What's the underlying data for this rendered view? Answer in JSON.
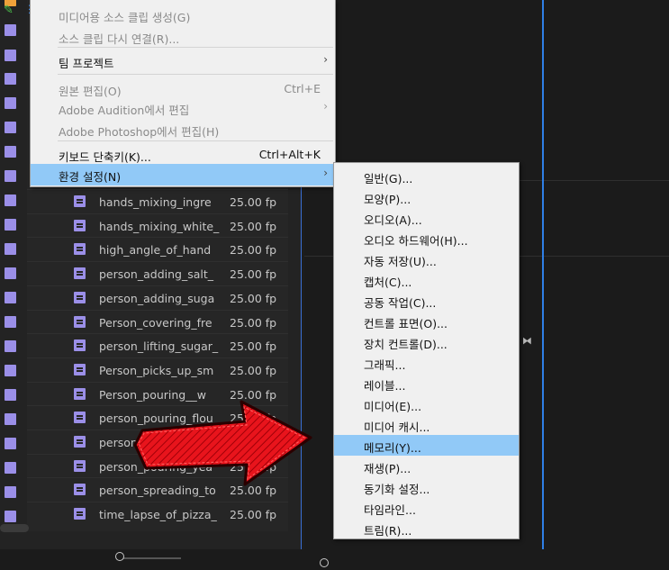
{
  "project_panel": {
    "clips": [
      {
        "name": "hands_mixing_ingre",
        "fps": "25.00 fps"
      },
      {
        "name": "hands_mixing_white_",
        "fps": "25.00 fps"
      },
      {
        "name": "high_angle_of_hand",
        "fps": "25.00 fps"
      },
      {
        "name": "person_adding_salt_",
        "fps": "25.00 fps"
      },
      {
        "name": "person_adding_suga",
        "fps": "25.00 fps"
      },
      {
        "name": "Person_covering_fre",
        "fps": "25.00 fps"
      },
      {
        "name": "person_lifting_sugar_",
        "fps": "25.00 fps"
      },
      {
        "name": "Person_picks_up_sm",
        "fps": "25.00 fps"
      },
      {
        "name": "Person_pouring__w",
        "fps": "25.00 fps"
      },
      {
        "name": "person_pouring_flou",
        "fps": "25.00 fps"
      },
      {
        "name": "person",
        "fps": ""
      },
      {
        "name": "person_pouring_yea",
        "fps": "25.00 fps"
      },
      {
        "name": "person_spreading_to",
        "fps": "25.00 fps"
      },
      {
        "name": "time_lapse_of_pizza_",
        "fps": "25.00 fps"
      }
    ]
  },
  "main_menu": {
    "items": [
      {
        "label": "미디어용 소스 클립 생성(G)",
        "shortcut": "",
        "disabled": true,
        "submenu": false
      },
      {
        "label": "소스 클립 다시 연결(R)...",
        "shortcut": "",
        "disabled": true,
        "submenu": false
      },
      {
        "label": "팀 프로젝트",
        "shortcut": "",
        "disabled": false,
        "submenu": true
      },
      {
        "label": "원본 편집(O)",
        "shortcut": "Ctrl+E",
        "disabled": true,
        "submenu": false
      },
      {
        "label": "Adobe Audition에서 편집",
        "shortcut": "",
        "disabled": true,
        "submenu": true
      },
      {
        "label": "Adobe Photoshop에서 편집(H)",
        "shortcut": "",
        "disabled": true,
        "submenu": false
      },
      {
        "label": "키보드 단축키(K)...",
        "shortcut": "Ctrl+Alt+K",
        "disabled": false,
        "submenu": false
      },
      {
        "label": "환경 설정(N)",
        "shortcut": "",
        "disabled": false,
        "submenu": true,
        "highlight": true
      }
    ]
  },
  "preferences_submenu": {
    "items": [
      "일반(G)...",
      "모양(P)...",
      "오디오(A)...",
      "오디오 하드웨어(H)...",
      "자동 저장(U)...",
      "캡처(C)...",
      "공동 작업(C)...",
      "컨트롤 표면(O)...",
      "장치 컨트롤(D)...",
      "그래픽...",
      "레이블...",
      "미디어(E)...",
      "미디어 캐시...",
      "메모리(Y)...",
      "재생(P)...",
      "동기화 설정...",
      "타임라인...",
      "트림(R)..."
    ],
    "highlighted_index": 13
  },
  "colors": {
    "menu_highlight": "#91c9f7",
    "clip_label": "#9b8fe8",
    "playhead": "#2f7fe6",
    "arrow": "#e8141c"
  },
  "icons": {
    "bowtie": "⧓",
    "pencil": "✎",
    "list_view": "☰",
    "icon_view": "▬",
    "freeform_view": "▤",
    "sort": "≡",
    "chevron": "⌄",
    "bin": "▥",
    "search": "⌕",
    "submenu_arrow": "›"
  }
}
